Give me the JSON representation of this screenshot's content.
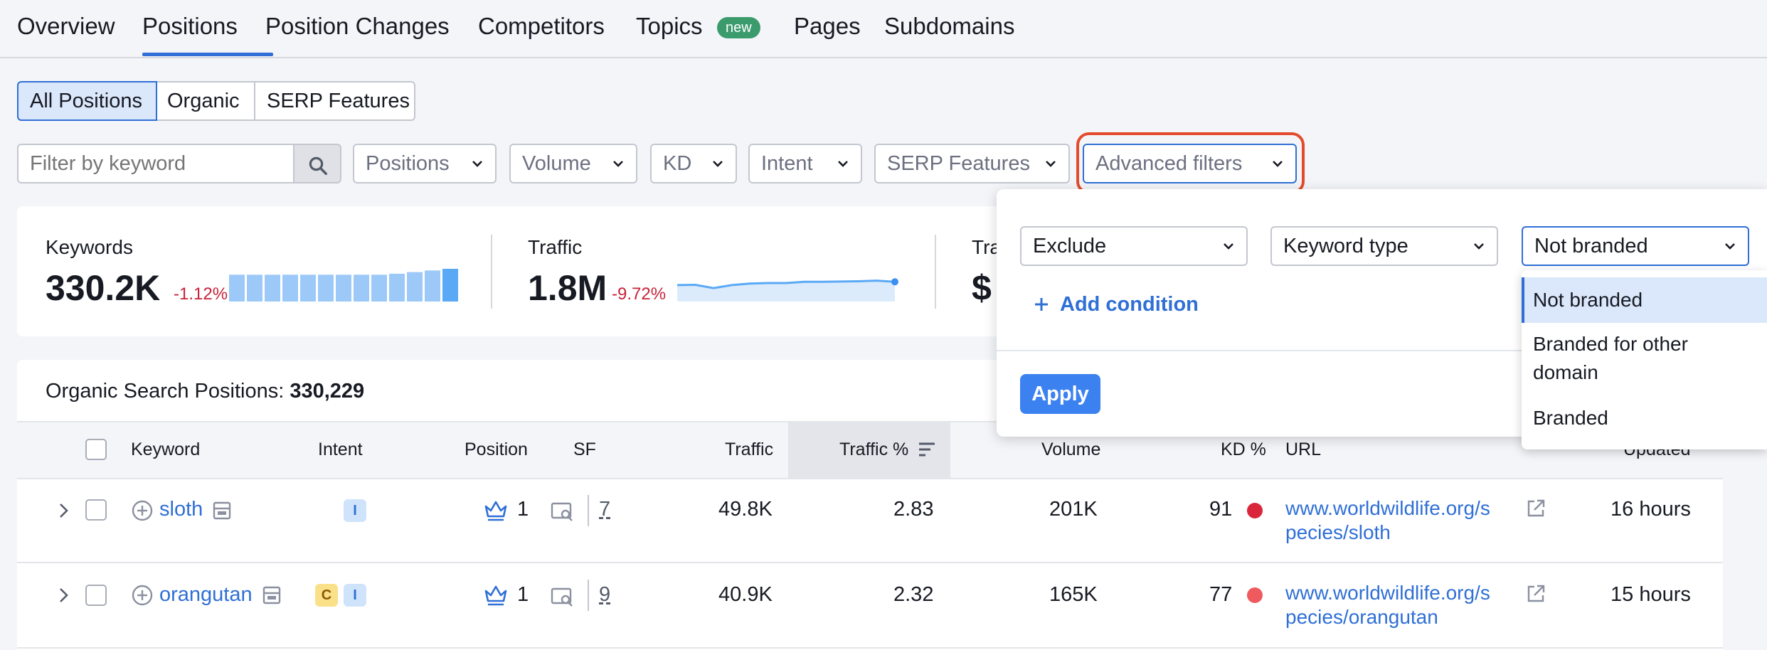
{
  "tabs": [
    {
      "label": "Overview"
    },
    {
      "label": "Positions"
    },
    {
      "label": "Position Changes"
    },
    {
      "label": "Competitors"
    },
    {
      "label": "Topics"
    },
    {
      "label": "Pages"
    },
    {
      "label": "Subdomains"
    }
  ],
  "topics_badge": "new",
  "segments": [
    "All Positions",
    "Organic",
    "SERP Features"
  ],
  "filters": {
    "keyword_placeholder": "Filter by keyword",
    "positions": "Positions",
    "volume": "Volume",
    "kd": "KD",
    "intent": "Intent",
    "serp": "SERP Features",
    "advanced": "Advanced filters"
  },
  "metrics": {
    "keywords": {
      "label": "Keywords",
      "value": "330.2K",
      "delta": "-1.12%"
    },
    "traffic": {
      "label": "Traffic",
      "value": "1.8M",
      "delta": "-9.72%"
    },
    "third_label": "Tra",
    "third_value": "$"
  },
  "keywords_trend": [
    0.82,
    0.82,
    0.82,
    0.82,
    0.82,
    0.82,
    0.82,
    0.82,
    0.82,
    0.85,
    0.9,
    0.95,
    1.0
  ],
  "traffic_trend": [
    0.55,
    0.56,
    0.45,
    0.55,
    0.6,
    0.62,
    0.62,
    0.66,
    0.66,
    0.67,
    0.68,
    0.7,
    0.66
  ],
  "table": {
    "title_prefix": "Organic Search Positions:",
    "title_count": "330,229",
    "headers": {
      "keyword": "Keyword",
      "intent": "Intent",
      "position": "Position",
      "sf": "SF",
      "traffic": "Traffic",
      "traffic_pct": "Traffic %",
      "volume": "Volume",
      "kd": "KD %",
      "url": "URL",
      "updated": "Updated"
    },
    "rows": [
      {
        "keyword": "sloth",
        "intents": [
          "I"
        ],
        "position": "1",
        "sf": "7",
        "traffic": "49.8K",
        "traffic_pct": "2.83",
        "volume": "201K",
        "kd": "91",
        "kd_color": "#d9263a",
        "url_line1": "www.worldwildlife.org/s",
        "url_line2": "pecies/sloth",
        "updated": "16 hours"
      },
      {
        "keyword": "orangutan",
        "intents": [
          "C",
          "I"
        ],
        "position": "1",
        "sf": "9",
        "traffic": "40.9K",
        "traffic_pct": "2.32",
        "volume": "165K",
        "kd": "77",
        "kd_color": "#ef5a5f",
        "url_line1": "www.worldwildlife.org/s",
        "url_line2": "pecies/orangutan",
        "updated": "15 hours"
      }
    ]
  },
  "advanced_panel": {
    "condition": "Exclude",
    "field": "Keyword type",
    "value": "Not branded",
    "add_condition": "Add condition",
    "apply": "Apply",
    "options": [
      "Not branded",
      "Branded for other domain",
      "Branded"
    ]
  },
  "colors": {
    "accent": "#2f6fd6",
    "highlight_ring": "#e44b2c",
    "delta_negative": "#c8233a"
  }
}
